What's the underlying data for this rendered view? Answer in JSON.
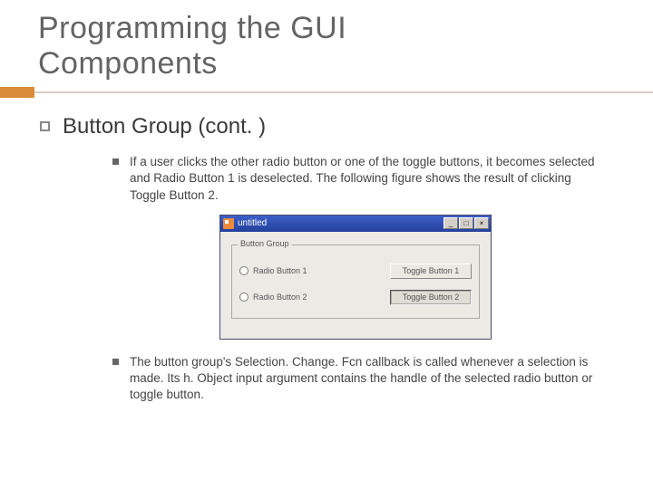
{
  "title_line1": "Programming the GUI",
  "title_line2": "Components",
  "section_heading": "Button Group (cont. )",
  "bullets": {
    "b1": "If a user clicks the other radio button or one of the toggle buttons, it becomes selected and Radio Button 1 is deselected. The following figure shows the result of clicking Toggle Button 2.",
    "b2": "The button group's Selection. Change. Fcn callback is called whenever a selection is made. Its h. Object input argument contains the handle of the selected radio button or toggle button."
  },
  "window": {
    "title": "untitled",
    "min": "_",
    "max": "□",
    "close": "×",
    "group_label": "Button Group",
    "radio1": "Radio Button 1",
    "radio2": "Radio Button 2",
    "toggle1": "Toggle Button 1",
    "toggle2": "Toggle Button 2"
  }
}
